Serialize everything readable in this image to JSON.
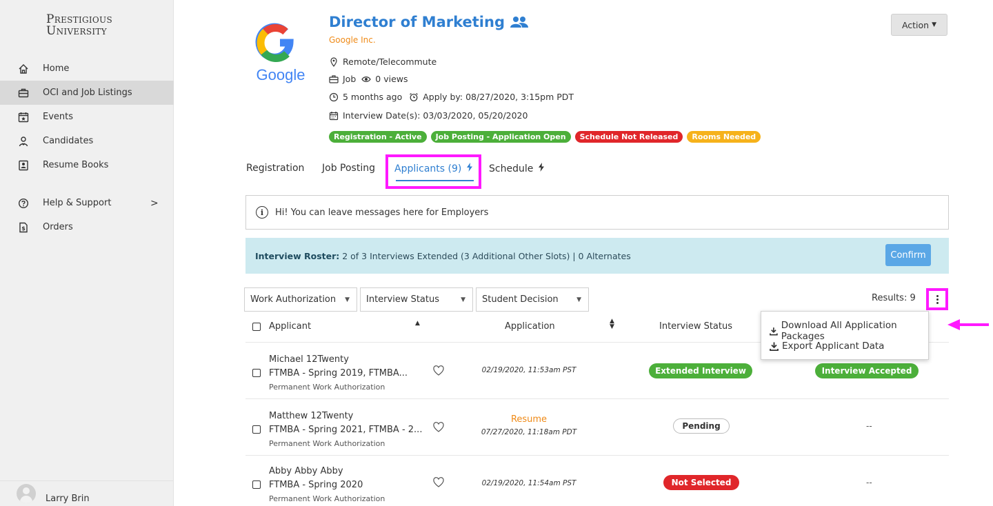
{
  "sidebar": {
    "logo_line1": "Prestigious",
    "logo_line2": "University",
    "items": [
      {
        "label": "Home"
      },
      {
        "label": "OCI and Job Listings"
      },
      {
        "label": "Events"
      },
      {
        "label": "Candidates"
      },
      {
        "label": "Resume Books"
      },
      {
        "label": "Help & Support"
      },
      {
        "label": "Orders"
      }
    ],
    "help_chevron": ">",
    "user_name": "Larry Brin"
  },
  "job": {
    "logo_text": "Google",
    "title": "Director of Marketing",
    "company": "Google Inc.",
    "location": "Remote/Telecommute",
    "type": "Job",
    "views": "0 views",
    "posted": "5 months ago",
    "apply_by": "Apply by: 08/27/2020, 3:15pm PDT",
    "interview_dates": "Interview Date(s): 03/03/2020, 05/20/2020",
    "badges": [
      {
        "label": "Registration - Active",
        "color": "#4caf3a"
      },
      {
        "label": "Job Posting - Application Open",
        "color": "#4caf3a"
      },
      {
        "label": "Schedule Not Released",
        "color": "#e0262a"
      },
      {
        "label": "Rooms Needed",
        "color": "#f6b21b"
      }
    ],
    "action_label": "Action"
  },
  "tabs": [
    {
      "label": "Registration"
    },
    {
      "label": "Job Posting"
    },
    {
      "label": "Applicants (9)"
    },
    {
      "label": "Schedule"
    }
  ],
  "message": "Hi!  You can leave messages here for Employers",
  "roster": {
    "label": "Interview Roster:",
    "text": "2 of 3 Interviews Extended (3 Additional Other Slots) | 0 Alternates",
    "confirm": "Confirm"
  },
  "filters": [
    "Work Authorization",
    "Interview Status",
    "Student Decision"
  ],
  "results": "Results: 9",
  "table": {
    "headers": [
      "Applicant",
      "Application",
      "Interview Status"
    ],
    "rows": [
      {
        "name": "Michael 12Twenty",
        "program": "FTMBA - Spring 2019, FTMBA...",
        "auth": "Permanent Work Authorization",
        "application_link": "",
        "application_date": "02/19/2020, 11:53am PST",
        "interview_status": "Extended Interview",
        "student_decision": "Interview Accepted"
      },
      {
        "name": "Matthew 12Twenty",
        "program": "FTMBA - Spring 2021, FTMBA - 2...",
        "auth": "Permanent Work Authorization",
        "application_link": "Resume",
        "application_date": "07/27/2020, 11:18am PDT",
        "interview_status": "Pending",
        "student_decision": "--"
      },
      {
        "name": "Abby Abby Abby",
        "program": "FTMBA - Spring 2020",
        "auth": "Permanent Work Authorization",
        "application_link": "",
        "application_date": "02/19/2020, 11:54am PST",
        "interview_status": "Not Selected",
        "student_decision": "--"
      }
    ]
  },
  "dropdown": {
    "items": [
      "Download All Application Packages",
      "Export Applicant Data"
    ]
  },
  "colors": {
    "accent": "#2f7fd1",
    "highlight": "#ff19ff",
    "orange": "#ef8a17",
    "green": "#4caf3a",
    "red": "#e0262a"
  }
}
